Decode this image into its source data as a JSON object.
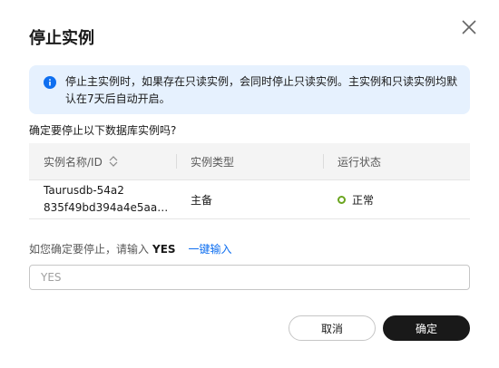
{
  "dialog": {
    "title": "停止实例",
    "alert_text": "停止主实例时，如果存在只读实例，会同时停止只读实例。主实例和只读实例均默认在7天后自动开启。",
    "question": "确定要停止以下数据库实例吗?",
    "table": {
      "headers": [
        "实例名称/ID",
        "实例类型",
        "运行状态"
      ],
      "rows": [
        {
          "name": "Taurusdb-54a2",
          "id": "835f49bd394a4e5aa…",
          "type": "主备",
          "status": "正常"
        }
      ]
    },
    "confirm_prompt": "如您确定要停止，请输入",
    "confirm_keyword": "YES",
    "auto_fill_link": "一键输入",
    "input": {
      "value": "",
      "placeholder": "YES"
    },
    "cancel_label": "取消",
    "ok_label": "确定"
  },
  "icons": {
    "close": "close-icon",
    "info": "info-icon",
    "sort": "sort-icon",
    "status": "status-dot-icon"
  },
  "colors": {
    "alert_bg": "#e6f1fe",
    "info_icon": "#0f6ff0",
    "link": "#0f6ff0",
    "status_ok": "#6aa51f",
    "primary_button": "#191919"
  }
}
